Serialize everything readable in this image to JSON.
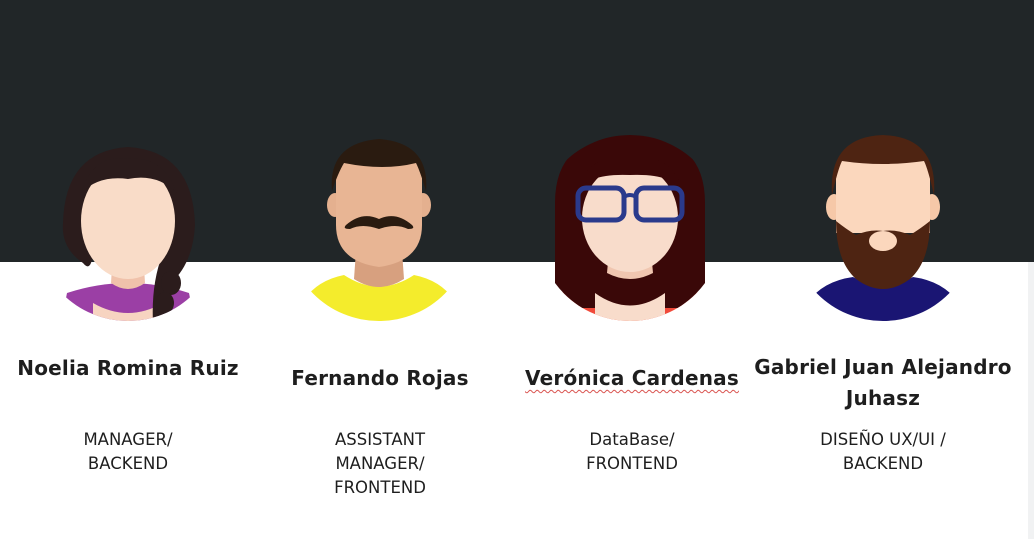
{
  "colors": {
    "header_band": "#212628",
    "background": "#ffffff",
    "text": "#1e1e1e"
  },
  "team": [
    {
      "name": "Noelia Romina Ruiz",
      "role": "MANAGER/\nBACKEND",
      "avatar": "woman-braid-avatar-icon",
      "shirt_color": "#9b3fa5"
    },
    {
      "name": "Fernando Rojas",
      "role": "ASSISTANT\nMANAGER/\nFRONTEND",
      "avatar": "man-mustache-avatar-icon",
      "shirt_color": "#f4ec2c"
    },
    {
      "name": "Verónica Cardenas",
      "role": "DataBase/\nFRONTEND",
      "avatar": "woman-glasses-avatar-icon",
      "shirt_color": "#f04a3a"
    },
    {
      "name": "Gabriel Juan Alejandro Juhasz",
      "role": "DISEÑO UX/UI /\nBACKEND",
      "avatar": "man-beard-avatar-icon",
      "shirt_color": "#1a1573"
    }
  ]
}
